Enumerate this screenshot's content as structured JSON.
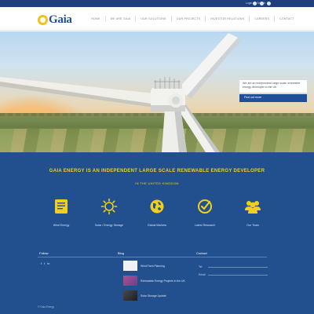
{
  "topbar": {
    "links": [
      "Login",
      "Search"
    ],
    "social_icons": [
      "facebook-icon",
      "twitter-icon",
      "linkedin-icon"
    ]
  },
  "header": {
    "logo_text": "Gaia",
    "nav": [
      "HOME",
      "WE ARE GAIA",
      "OUR SOLUTIONS",
      "OUR PROJECTS",
      "INVESTOR RELATIONS",
      "CAREERS",
      "CONTACT"
    ]
  },
  "hero": {
    "caption_text": "We are an independent large scale renewable energy developer in the UK",
    "caption_button": "Find out more",
    "slides": 5,
    "active_slide": 2
  },
  "main": {
    "headline": "GAIA ENERGY IS AN INDEPENDENT LARGE SCALE RENEWABLE ENERGY DEVELOPER",
    "subline": "IN THE UNITED KINGDOM",
    "features": [
      {
        "icon": "document-icon",
        "label": "Wind Energy"
      },
      {
        "icon": "sun-icon",
        "label": "Solar / Energy Storage"
      },
      {
        "icon": "globe-icon",
        "label": "Global Markets"
      },
      {
        "icon": "check-circle-icon",
        "label": "Latest Research"
      },
      {
        "icon": "people-icon",
        "label": "Our Team"
      }
    ]
  },
  "footer": {
    "follow_title": "Follow",
    "follow_icons": [
      "f",
      "t",
      "in"
    ],
    "blog_title": "Blog",
    "posts": [
      {
        "thumb_color": "#f2f2f2",
        "title": "Wind Farm Planning"
      },
      {
        "thumb_color": "#9a4a82",
        "title": "Renewable Energy Projects in the UK"
      },
      {
        "thumb_color": "#3a3a3a",
        "title": "Solar Storage Update"
      }
    ],
    "contact_title": "Contact",
    "contact_fields": [
      "Tel",
      "Email"
    ],
    "copyright": "© Gaia Energy"
  },
  "colors": {
    "navy": "#22508f",
    "topbar": "#1f3f7c",
    "accent_yellow": "#f1cf1a",
    "logo_blue": "#1f4f9a"
  }
}
